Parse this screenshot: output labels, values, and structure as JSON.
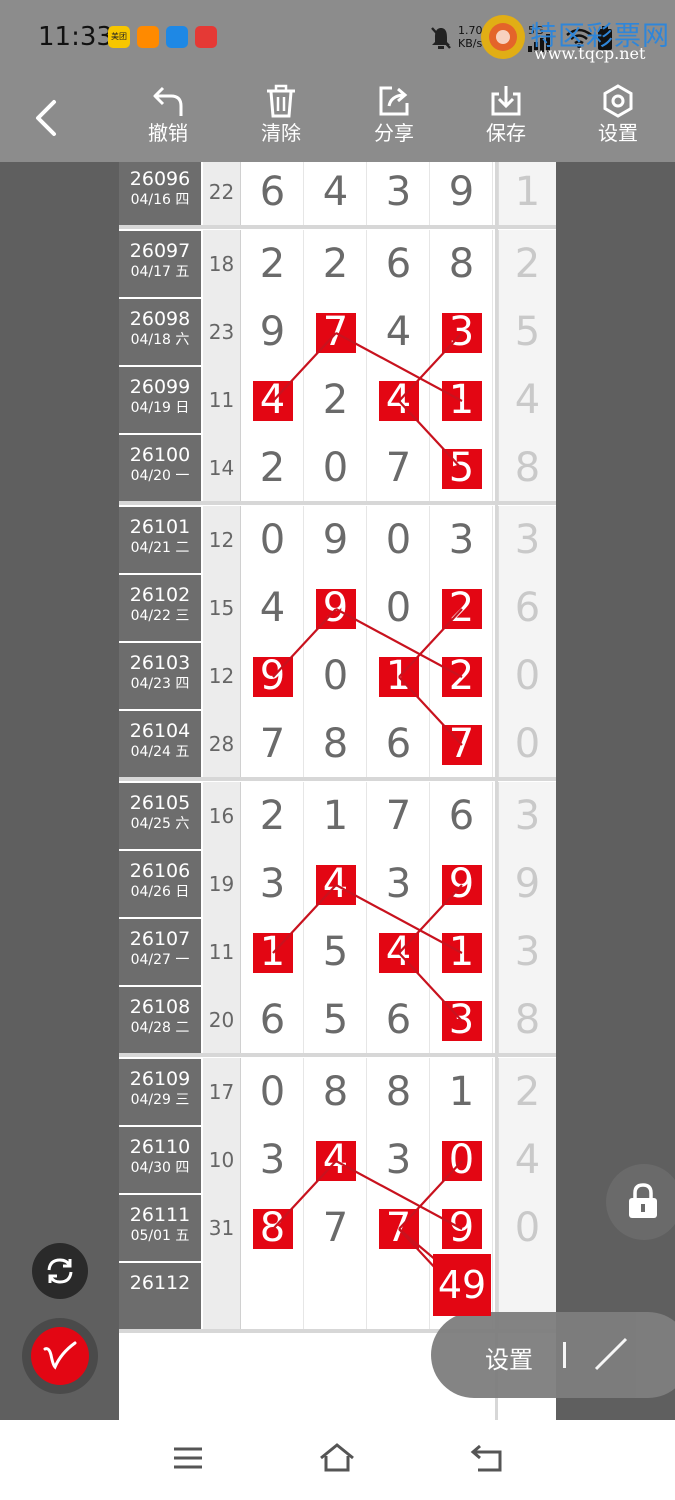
{
  "status_bar": {
    "time": "11:33",
    "app_icons": [
      {
        "name": "meituan-icon",
        "text": "美团",
        "color": "#f7c600"
      },
      {
        "name": "video-app-icon",
        "text": "",
        "color": "#ff8a00"
      },
      {
        "name": "cloud-app-icon",
        "text": "",
        "color": "#1e88e5"
      },
      {
        "name": "calendar-app-icon",
        "text": "",
        "color": "#e53935"
      }
    ],
    "net_speed": "1.70 KB/s",
    "network": "5G"
  },
  "watermark": {
    "title": "特区彩票网",
    "url": "www.tqcp.net"
  },
  "toolbar": {
    "undo_label": "撤销",
    "clear_label": "清除",
    "share_label": "分享",
    "save_label": "保存",
    "settings_label": "设置"
  },
  "rows": [
    {
      "issue": "26096",
      "date": "04/16 四",
      "sum": "22",
      "digits": [
        "6",
        "4",
        "3",
        "9"
      ],
      "hl": [
        false,
        false,
        false,
        false
      ],
      "tail": "1"
    },
    {
      "issue": "26097",
      "date": "04/17 五",
      "sum": "18",
      "digits": [
        "2",
        "2",
        "6",
        "8"
      ],
      "hl": [
        false,
        false,
        false,
        false
      ],
      "tail": "2"
    },
    {
      "issue": "26098",
      "date": "04/18 六",
      "sum": "23",
      "digits": [
        "9",
        "7",
        "4",
        "3"
      ],
      "hl": [
        false,
        true,
        false,
        true
      ],
      "tail": "5"
    },
    {
      "issue": "26099",
      "date": "04/19 日",
      "sum": "11",
      "digits": [
        "4",
        "2",
        "4",
        "1"
      ],
      "hl": [
        true,
        false,
        true,
        true
      ],
      "tail": "4"
    },
    {
      "issue": "26100",
      "date": "04/20 一",
      "sum": "14",
      "digits": [
        "2",
        "0",
        "7",
        "5"
      ],
      "hl": [
        false,
        false,
        false,
        true
      ],
      "tail": "8"
    },
    {
      "issue": "26101",
      "date": "04/21 二",
      "sum": "12",
      "digits": [
        "0",
        "9",
        "0",
        "3"
      ],
      "hl": [
        false,
        false,
        false,
        false
      ],
      "tail": "3"
    },
    {
      "issue": "26102",
      "date": "04/22 三",
      "sum": "15",
      "digits": [
        "4",
        "9",
        "0",
        "2"
      ],
      "hl": [
        false,
        true,
        false,
        true
      ],
      "tail": "6"
    },
    {
      "issue": "26103",
      "date": "04/23 四",
      "sum": "12",
      "digits": [
        "9",
        "0",
        "1",
        "2"
      ],
      "hl": [
        true,
        false,
        true,
        true
      ],
      "tail": "0"
    },
    {
      "issue": "26104",
      "date": "04/24 五",
      "sum": "28",
      "digits": [
        "7",
        "8",
        "6",
        "7"
      ],
      "hl": [
        false,
        false,
        false,
        true
      ],
      "tail": "0"
    },
    {
      "issue": "26105",
      "date": "04/25 六",
      "sum": "16",
      "digits": [
        "2",
        "1",
        "7",
        "6"
      ],
      "hl": [
        false,
        false,
        false,
        false
      ],
      "tail": "3"
    },
    {
      "issue": "26106",
      "date": "04/26 日",
      "sum": "19",
      "digits": [
        "3",
        "4",
        "3",
        "9"
      ],
      "hl": [
        false,
        true,
        false,
        true
      ],
      "tail": "9"
    },
    {
      "issue": "26107",
      "date": "04/27 一",
      "sum": "11",
      "digits": [
        "1",
        "5",
        "4",
        "1"
      ],
      "hl": [
        true,
        false,
        true,
        true
      ],
      "tail": "3"
    },
    {
      "issue": "26108",
      "date": "04/28 二",
      "sum": "20",
      "digits": [
        "6",
        "5",
        "6",
        "3"
      ],
      "hl": [
        false,
        false,
        false,
        true
      ],
      "tail": "8"
    },
    {
      "issue": "26109",
      "date": "04/29 三",
      "sum": "17",
      "digits": [
        "0",
        "8",
        "8",
        "1"
      ],
      "hl": [
        false,
        false,
        false,
        false
      ],
      "tail": "2"
    },
    {
      "issue": "26110",
      "date": "04/30 四",
      "sum": "10",
      "digits": [
        "3",
        "4",
        "3",
        "0"
      ],
      "hl": [
        false,
        true,
        false,
        true
      ],
      "tail": "4"
    },
    {
      "issue": "26111",
      "date": "05/01 五",
      "sum": "31",
      "digits": [
        "8",
        "7",
        "7",
        "9"
      ],
      "hl": [
        true,
        false,
        true,
        true
      ],
      "tail": "0"
    },
    {
      "issue": "26112",
      "date": "",
      "sum": "",
      "digits": [
        "",
        "",
        "",
        ""
      ],
      "hl": [
        false,
        false,
        false,
        false
      ],
      "tail": ""
    }
  ],
  "prediction": "49",
  "floating": {
    "settings_label": "设置"
  },
  "colors": {
    "accent": "#e30613",
    "toolbar": "#8c8c8c",
    "background": "#5f5f5f"
  }
}
